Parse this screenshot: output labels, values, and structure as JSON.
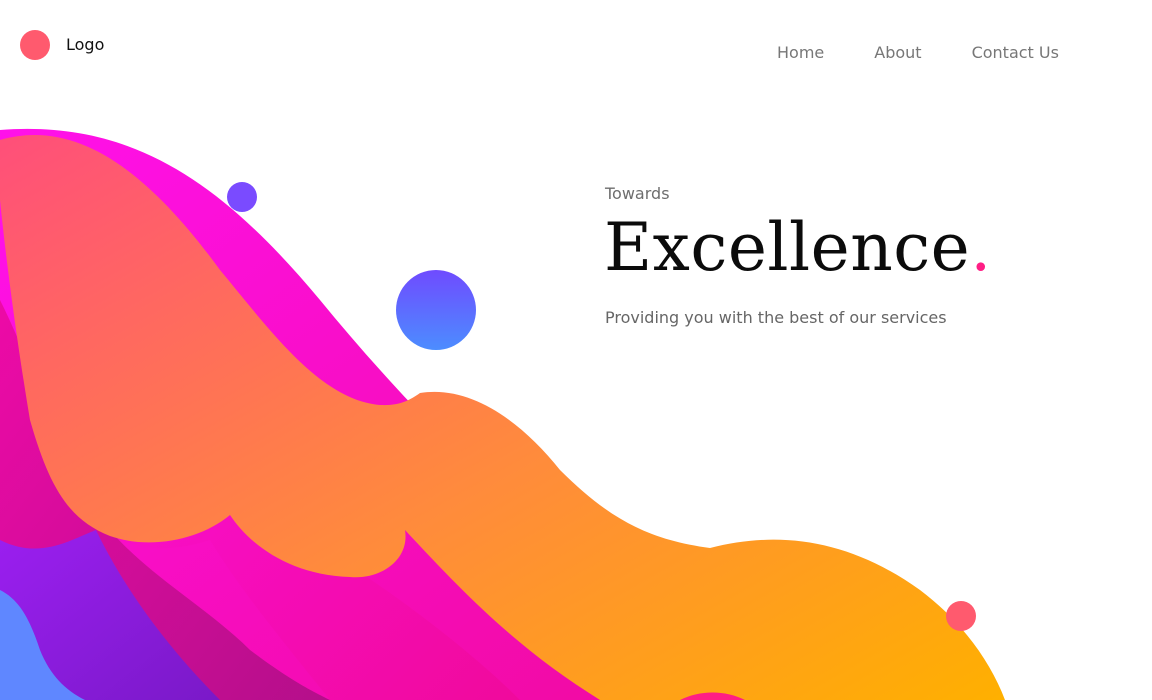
{
  "header": {
    "logo_label": "Logo",
    "nav": [
      {
        "label": "Home"
      },
      {
        "label": "About"
      },
      {
        "label": "Contact Us"
      }
    ]
  },
  "hero": {
    "kicker": "Towards",
    "title": "Excellence",
    "title_accent": ".",
    "subtitle": "Providing you with the best of our services"
  },
  "colors": {
    "logo_dot": "#ff5a6e",
    "accent_dot": "#ff1e85",
    "circle_purple": "#7a4bff",
    "circle_gradient_top": "#6f4bff",
    "circle_gradient_bottom": "#4c8dff",
    "circle_coral": "#ff5a6e",
    "wave_front_start": "#ff4f7a",
    "wave_front_end": "#ffb000",
    "wave_magenta": "#ff11ea",
    "wave_deep_pink": "#c8108f",
    "wave_purple": "#8e1de6",
    "wave_blue": "#5f87ff"
  }
}
